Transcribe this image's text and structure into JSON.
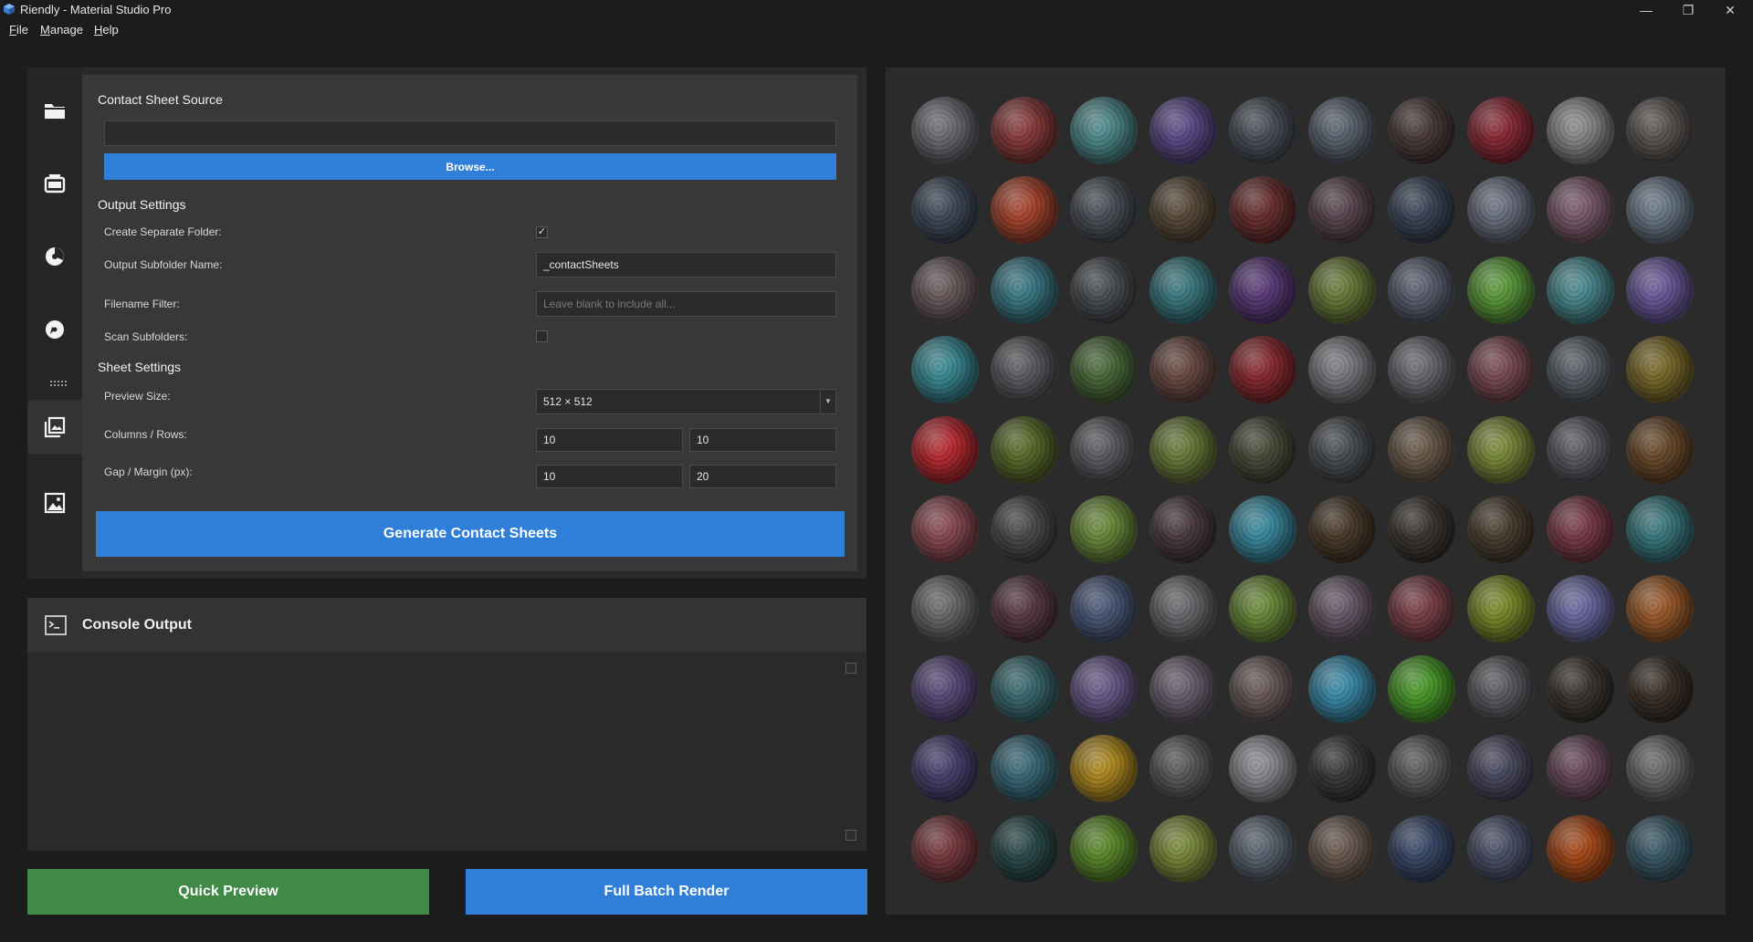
{
  "window": {
    "title": "Riendly - Material Studio Pro",
    "minimize_glyph": "—",
    "restore_glyph": "❐",
    "close_glyph": "✕"
  },
  "menu": {
    "file": {
      "underline": "F",
      "rest": "ile"
    },
    "manage": {
      "underline": "M",
      "rest": "anage"
    },
    "help": {
      "underline": "H",
      "rest": "elp"
    }
  },
  "nav": {
    "icons": [
      "folder-icon",
      "film-icon",
      "color-wheel-icon",
      "gauge-icon",
      "dots-separator-icon",
      "gallery-icon",
      "image-icon"
    ],
    "active": "gallery-icon"
  },
  "source": {
    "title": "Contact Sheet Source",
    "path_value": "",
    "browse_label": "Browse..."
  },
  "output": {
    "title": "Output Settings",
    "separate_folder_label": "Create Separate Folder:",
    "separate_folder_checked": true,
    "check_glyph": "✓",
    "subfolder_label": "Output Subfolder Name:",
    "subfolder_value": "_contactSheets",
    "filter_label": "Filename Filter:",
    "filter_placeholder": "Leave blank to include all...",
    "filter_value": "",
    "scan_label": "Scan Subfolders:",
    "scan_checked": false
  },
  "sheet": {
    "title": "Sheet Settings",
    "preview_size_label": "Preview Size:",
    "preview_size_value": "512 × 512",
    "columns_rows_label": "Columns / Rows:",
    "columns_value": "10",
    "rows_value": "10",
    "gap_margin_label": "Gap / Margin (px):",
    "gap_value": "10",
    "margin_value": "20"
  },
  "generate_label": "Generate Contact Sheets",
  "console": {
    "title": "Console Output",
    "text": ""
  },
  "actions": {
    "quick_preview_label": "Quick Preview",
    "full_batch_label": "Full Batch Render",
    "quick_preview_color": "#3f8a45",
    "full_batch_color": "#2f7fd8"
  },
  "colors": {
    "accent": "#2f7fd8",
    "success": "#3f8a45"
  },
  "preview": {
    "columns": 10,
    "rows": 10,
    "sphere_colors": [
      "#6b6b73",
      "#8a3b3b",
      "#4e8a8c",
      "#5c4a88",
      "#4a505a",
      "#5a6470",
      "#4a3a3a",
      "#8a2a35",
      "#8a8a8a",
      "#5a5552",
      "#3f4a5a",
      "#a8452e",
      "#4a5058",
      "#5a4a3a",
      "#6a2f2f",
      "#5a4650",
      "#3a4658",
      "#6a7080",
      "#7a5a6a",
      "#6a7888",
      "#6a5a5c",
      "#3a7a86",
      "#4a4e52",
      "#3a7a80",
      "#5a3a78",
      "#6a7a3a",
      "#5a6070",
      "#5a9a3a",
      "#4a8a90",
      "#6a5a9a",
      "#3a8a94",
      "#5a5c60",
      "#4a6a3a",
      "#6a4a42",
      "#8a2a30",
      "#7a7c80",
      "#6a6a70",
      "#7a4a52",
      "#5a6068",
      "#7a6a2a",
      "#b82a30",
      "#5a6a2a",
      "#5a5c60",
      "#6a7a3a",
      "#4a4a3a",
      "#4a4e52",
      "#6a5a4a",
      "#7a8a3a",
      "#5a5c62",
      "#6a4a2a",
      "#8a4a52",
      "#4a4a4c",
      "#6a8a3a",
      "#4a3a3e",
      "#3a8aa0",
      "#4a3a2a",
      "#3a3530",
      "#4a3e30",
      "#7a3a48",
      "#3a7a80",
      "#6a6a6c",
      "#5a3a44",
      "#4a5878",
      "#6a6a6e",
      "#6a8a3a",
      "#6a5a6a",
      "#7a4048",
      "#7a8a2a",
      "#6a68a0",
      "#9a5a2a",
      "#5a4a7a",
      "#3a6a70",
      "#6a5a8a",
      "#6a6070",
      "#6a5a5a",
      "#3a8aa8",
      "#4a9a2a",
      "#5a5c60",
      "#3a352e",
      "#3a3028",
      "#4a4070",
      "#3a6a7a",
      "#b08a20",
      "#5a5a5a",
      "#8a8c90",
      "#3a3a3c",
      "#5a5c5e",
      "#4a4a60",
      "#6a4a5a",
      "#6a6a6c",
      "#7a3a40",
      "#2a4a4a",
      "#5a8a2a",
      "#7a8a3a",
      "#5a6470",
      "#6a5a50",
      "#3a4a6a",
      "#4a5068",
      "#a84a1a",
      "#3a5a68"
    ]
  }
}
